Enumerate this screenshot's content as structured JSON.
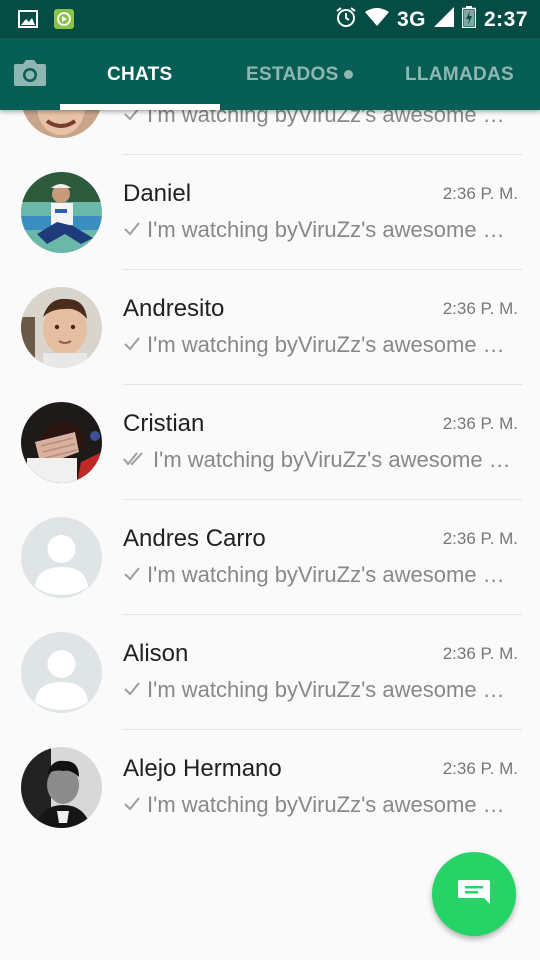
{
  "status_bar": {
    "network": "3G",
    "time": "2:37",
    "icons": [
      "gallery-icon",
      "media-player-icon",
      "alarm-icon",
      "wifi-icon",
      "signal-icon",
      "battery-icon"
    ]
  },
  "tabs": {
    "chats": "CHATS",
    "estados": "ESTADOS",
    "llamadas": "LLAMADAS"
  },
  "chats": [
    {
      "name": "",
      "time": "",
      "message": "I'm watching byViruZz's awesome video",
      "check": "single"
    },
    {
      "name": "Daniel",
      "time": "2:36 P. M.",
      "message": "I'm watching byViruZz's awesome video",
      "check": "single"
    },
    {
      "name": "Andresito",
      "time": "2:36 P. M.",
      "message": "I'm watching byViruZz's awesome video",
      "check": "single"
    },
    {
      "name": "Cristian",
      "time": "2:36 P. M.",
      "message": "I'm watching byViruZz's awesome video",
      "check": "double"
    },
    {
      "name": "Andres Carro",
      "time": "2:36 P. M.",
      "message": "I'm watching byViruZz's awesome video",
      "check": "single"
    },
    {
      "name": "Alison",
      "time": "2:36 P. M.",
      "message": "I'm watching byViruZz's awesome video",
      "check": "single"
    },
    {
      "name": "Alejo Hermano",
      "time": "2:36 P. M.",
      "message": "I'm watching byViruZz's awesome video",
      "check": "single"
    }
  ],
  "colors": {
    "status_bar": "#054d44",
    "app_bar": "#075e54",
    "fab": "#25d366",
    "check_grey": "#9e9e9e"
  }
}
